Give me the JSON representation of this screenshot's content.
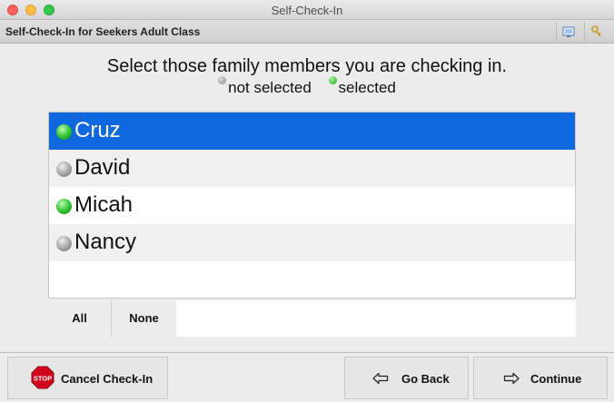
{
  "window": {
    "title": "Self-Check-In"
  },
  "header": {
    "title": "Self-Check-In for Seekers Adult Class"
  },
  "instruction": "Select those family members you are checking in.",
  "legend": {
    "not_selected": "not selected",
    "selected": "selected"
  },
  "members": [
    {
      "name": "Cruz",
      "selected": true,
      "highlighted": true
    },
    {
      "name": "David",
      "selected": false,
      "highlighted": false
    },
    {
      "name": "Micah",
      "selected": true,
      "highlighted": false
    },
    {
      "name": "Nancy",
      "selected": false,
      "highlighted": false
    }
  ],
  "selection_buttons": {
    "all": "All",
    "none": "None"
  },
  "footer": {
    "cancel": "Cancel Check-In",
    "stop_sign": "STOP",
    "back": "Go Back",
    "continue": "Continue"
  },
  "colors": {
    "highlight": "#1167dd",
    "selected_dot": "#2bc02b",
    "unselected_dot": "#a3a3a3",
    "stop_red": "#d0021b"
  }
}
